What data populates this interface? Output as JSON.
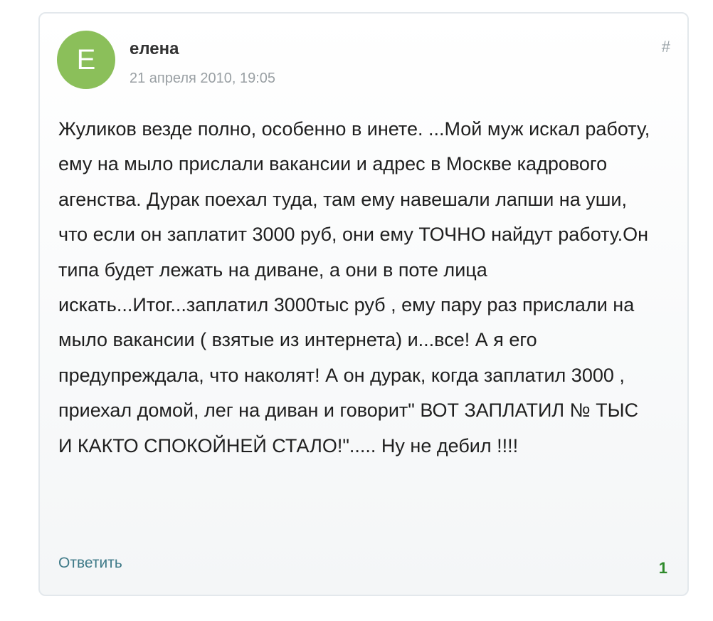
{
  "comment": {
    "avatar_letter": "E",
    "avatar_color": "#8bbf5a",
    "author": "елена",
    "date": "21 апреля 2010, 19:05",
    "permalink_label": "#",
    "text": "Жуликов везде полно, особенно в инете. ...Мой муж искал работу, ему на мыло прислали вакансии и адрес в Москве кадрового агенства. Дурак поехал туда, там ему навешали лапши на уши, что если он заплатит 3000 руб, они ему ТОЧНО найдут работу.Он типа будет лежать на диване, а они в поте лица искать...Итог...заплатил 3000тыс руб , ему пару раз прислали на мыло вакансии ( взятые из интернета) и...все! А я его предупреждала, что наколят! А он дурак, когда заплатил 3000 , приехал домой, лег на диван и говорит\" ВОТ ЗАПЛАТИЛ № ТЫС И КАКТО СПОКОЙНЕЙ СТАЛО!\"..... Ну не дебил !!!!",
    "reply_label": "Ответить",
    "rating": "1",
    "rating_color": "#2f8a2b"
  }
}
